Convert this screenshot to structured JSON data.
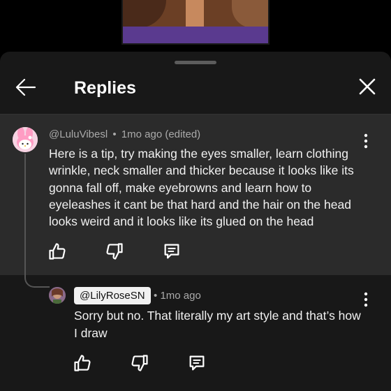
{
  "header": {
    "title": "Replies"
  },
  "parent_comment": {
    "author": "@LuluVibesl",
    "separator": "•",
    "time": "1mo ago (edited)",
    "text": "Here is a tip, try making the eyes smaller, learn clothing wrinkle, neck smaller and thicker because it looks like its gonna fall off, make eyebrowns and learn how to eyeleashes it cant be that hard and the hair on the head looks weird and it looks like its glued on the head"
  },
  "reply": {
    "author": "@LilyRoseSN",
    "separator": "•",
    "time": "1mo ago",
    "text": "Sorry but no. That literally my art style and that’s how I draw"
  },
  "icons": {
    "back": "arrow-left-icon",
    "close": "close-icon",
    "more": "more-vertical-icon",
    "like": "thumbs-up-icon",
    "dislike": "thumbs-down-icon",
    "reply": "comment-icon"
  },
  "colors": {
    "background": "#000000",
    "panel": "#181818",
    "highlight": "#2b2b2b",
    "secondary_text": "#aaaaaa",
    "chip": "#f1f1f1"
  }
}
